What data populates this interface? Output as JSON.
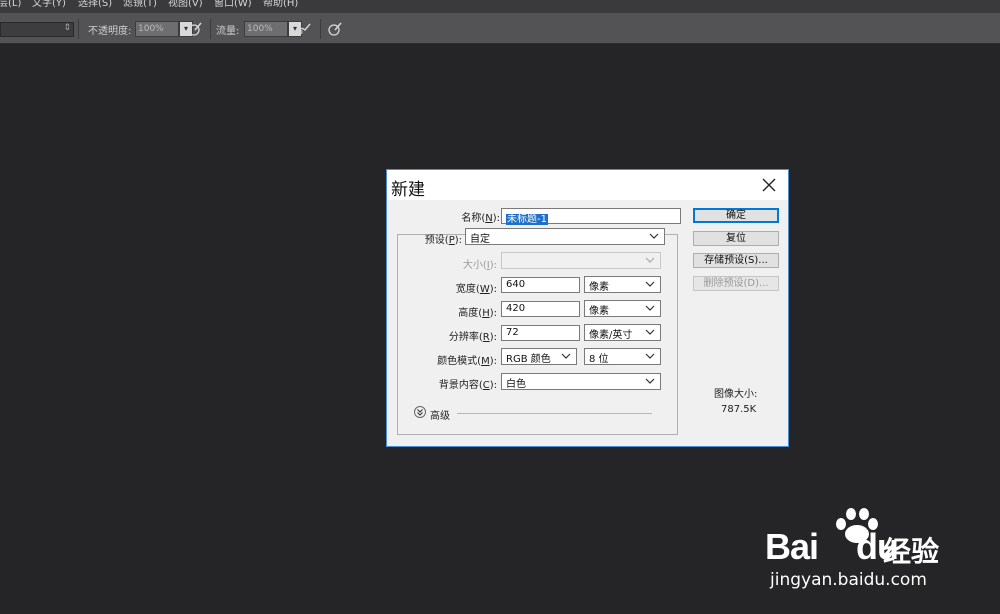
{
  "menubar": {
    "items": [
      "层(L)",
      "文字(Y)",
      "选择(S)",
      "滤镜(T)",
      "视图(V)",
      "窗口(W)",
      "帮助(H)"
    ]
  },
  "optionsbar": {
    "opacity_label": "不透明度:",
    "opacity_value": "100%",
    "flow_label": "流量:",
    "flow_value": "100%"
  },
  "dialog": {
    "title": "新建",
    "name_label_prefix": "名称(",
    "name_label_key": "N",
    "name_label_suffix": "):",
    "name_value": "未标题-1",
    "preset_label_prefix": "预设(",
    "preset_label_key": "P",
    "preset_label_suffix": "):",
    "preset_value": "自定",
    "size_label_prefix": "大小(",
    "size_label_key": "I",
    "size_label_suffix": "):",
    "width_label_prefix": "宽度(",
    "width_label_key": "W",
    "width_label_suffix": "):",
    "width_value": "640",
    "width_unit": "像素",
    "height_label_prefix": "高度(",
    "height_label_key": "H",
    "height_label_suffix": "):",
    "height_value": "420",
    "height_unit": "像素",
    "resolution_label_prefix": "分辨率(",
    "resolution_label_key": "R",
    "resolution_label_suffix": "):",
    "resolution_value": "72",
    "resolution_unit": "像素/英寸",
    "colormode_label_prefix": "颜色模式(",
    "colormode_label_key": "M",
    "colormode_label_suffix": "):",
    "colormode_value": "RGB 颜色",
    "bitdepth_value": "8 位",
    "background_label_prefix": "背景内容(",
    "background_label_key": "C",
    "background_label_suffix": "):",
    "background_value": "白色",
    "advanced_label": "高级",
    "image_size_label": "图像大小:",
    "image_size_value": "787.5K",
    "buttons": {
      "ok": "确定",
      "reset": "复位",
      "save_preset": "存储预设(S)...",
      "delete_preset": "删除预设(D)..."
    }
  },
  "watermark": {
    "brand": "Bai",
    "brand_suffix": "du",
    "chinese": "经验",
    "url": "jingyan.baidu.com"
  },
  "colors": {
    "canvas_bg": "#252426",
    "dialog_border": "#4a8fd6",
    "selection": "#1e70c8"
  }
}
